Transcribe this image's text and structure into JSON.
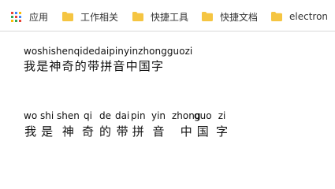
{
  "bookmarks": {
    "apps_label": "应用",
    "items": [
      {
        "label": "工作相关",
        "icon": "folder-icon"
      },
      {
        "label": "快捷工具",
        "icon": "folder-icon"
      },
      {
        "label": "快捷文档",
        "icon": "folder-icon"
      },
      {
        "label": "electron",
        "icon": "folder-icon"
      }
    ],
    "folder_color": "#f5c542",
    "apps_grid_colors": [
      "#e94235",
      "#4285f4",
      "#fbbc05",
      "#34a853",
      "#e94235",
      "#4285f4",
      "#fbbc05",
      "#34a853",
      "#e94235"
    ]
  },
  "example1": {
    "pinyin": "woshishenqidedaipinyinzhongguozi",
    "hanzi": "我是神奇的带拼音中国字"
  },
  "example2": {
    "pairs": [
      {
        "py": "wo",
        "hz": "我"
      },
      {
        "py": "shi",
        "hz": "是"
      },
      {
        "py": "shen",
        "hz": "神"
      },
      {
        "py": "qi",
        "hz": "奇"
      },
      {
        "py": "de",
        "hz": "的"
      },
      {
        "py": "dai",
        "hz": "带"
      },
      {
        "py": "pin",
        "hz": "拼"
      },
      {
        "py": "yin",
        "hz": "音"
      },
      {
        "py": "zhong",
        "hz": "中"
      },
      {
        "py": "guo",
        "hz": "国"
      },
      {
        "py": "zi",
        "hz": "字"
      }
    ]
  }
}
